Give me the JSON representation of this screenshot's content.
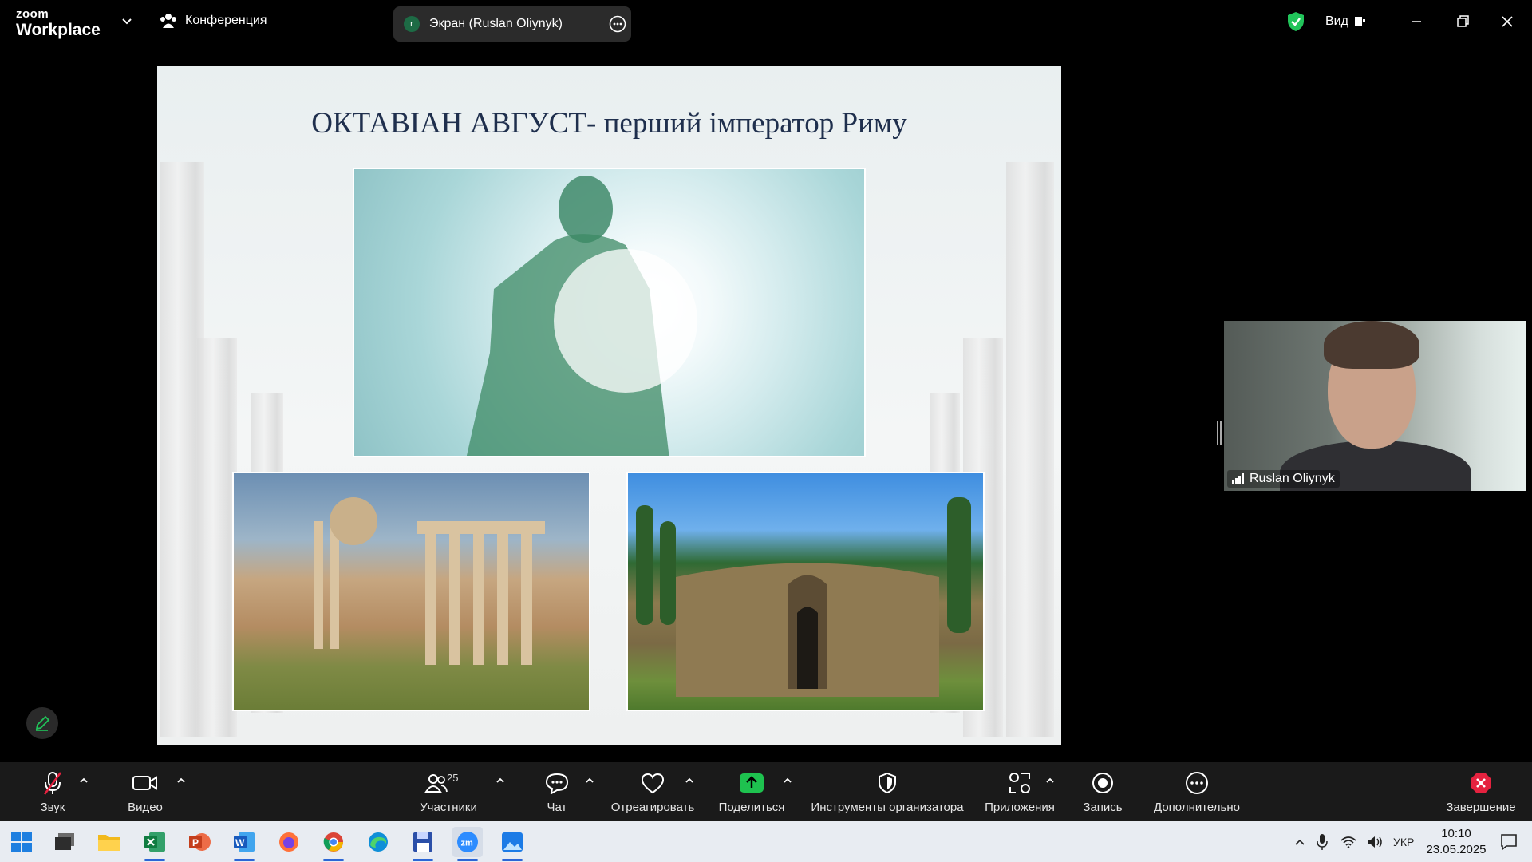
{
  "topbar": {
    "logo_small": "zoom",
    "logo_big": "Workplace",
    "meeting_label": "Конференция",
    "screen_share_avatar": "r",
    "screen_share_label": "Экран (Ruslan Oliynyk)",
    "view_label": "Вид",
    "colors": {
      "shield": "#21c45a",
      "pill_bg": "#2b2b2b"
    }
  },
  "slide": {
    "title": "ОКТАВІАН АВГУСТ- перший імператор Риму",
    "title_color": "#1f2f4d"
  },
  "participant_video": {
    "name": "Ruslan Oliynyk"
  },
  "toolbar": {
    "audio_label": "Звук",
    "video_label": "Видео",
    "participants_label": "Участники",
    "participants_count": "25",
    "chat_label": "Чат",
    "react_label": "Отреагировать",
    "share_label": "Поделиться",
    "host_tools_label": "Инструменты организатора",
    "apps_label": "Приложения",
    "record_label": "Запись",
    "more_label": "Дополнительно",
    "end_label": "Завершение",
    "colors": {
      "share": "#1ec24f",
      "end": "#e5223f",
      "mute": "#e5223f"
    }
  },
  "taskbar": {
    "apps": [
      "windows-start",
      "task-view",
      "file-explorer",
      "excel",
      "powerpoint",
      "word",
      "firefox",
      "chrome",
      "edge",
      "floppy-app",
      "zoom",
      "photos"
    ],
    "language": "УКР",
    "time": "10:10",
    "date": "23.05.2025"
  }
}
